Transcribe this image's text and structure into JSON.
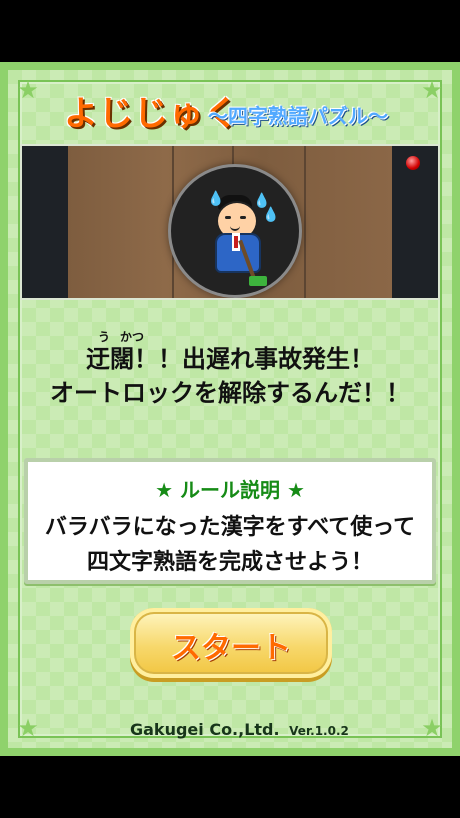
{
  "title": {
    "main": "よじじゅく",
    "subtitle": "〜四字熟語パズル〜"
  },
  "story": {
    "ruby_1": "う",
    "ruby_2": "かつ",
    "line_1": "迂闊！！出遅れ事故発生！",
    "line_2": "オートロックを解除するんだ！！"
  },
  "rules": {
    "title": "★ ルール説明 ★",
    "line_1": "バラバラになった漢字をすべて使って",
    "line_2": "四文字熟語を完成させよう！"
  },
  "buttons": {
    "start": "スタート"
  },
  "footer": {
    "company": "Gakugei Co.,Ltd.",
    "version": "Ver.1.0.2"
  },
  "icons": {
    "corner": "corner-decoration-icon",
    "alarm": "red-light-icon"
  },
  "colors": {
    "board": "#bfe7a5",
    "accent_orange": "#ff6a00",
    "accent_blue": "#52a9ff",
    "rules_green": "#168b16"
  }
}
